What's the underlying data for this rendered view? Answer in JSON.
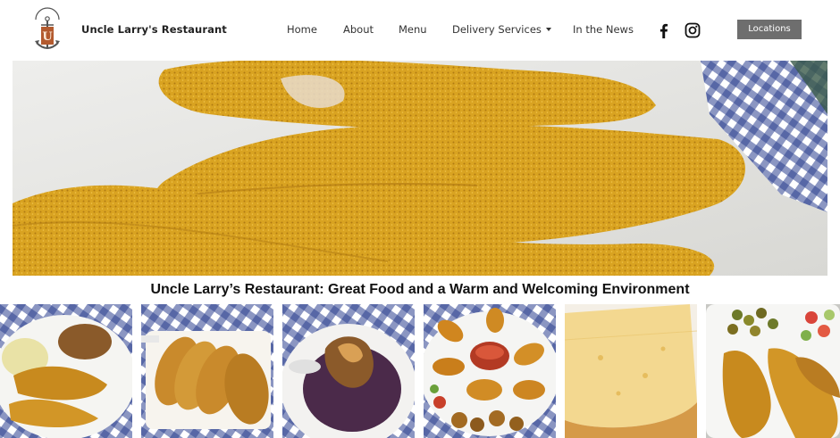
{
  "header": {
    "brand": "Uncle Larry's Restaurant",
    "logo_icon": "anchor-logo-icon",
    "nav": [
      {
        "label": "Home"
      },
      {
        "label": "About"
      },
      {
        "label": "Menu"
      },
      {
        "label": "Delivery Services",
        "has_dropdown": true
      },
      {
        "label": "In the News"
      }
    ],
    "social": [
      "facebook-icon",
      "instagram-icon"
    ],
    "cta_label": "Locations",
    "cta_color": "#6e6e6e"
  },
  "hero": {
    "subject": "fried-catfish-fillets-photo"
  },
  "headline": "Uncle Larry’s Restaurant: Great Food and a Warm and Welcoming Environment",
  "gallery": [
    {
      "subject": "catfish-plate-with-beans-and-cabbage"
    },
    {
      "subject": "hot-water-cornbread"
    },
    {
      "subject": "peach-cobbler-with-ice-cream"
    },
    {
      "subject": "fried-shrimp-platter"
    },
    {
      "subject": "cornbread-slice"
    },
    {
      "subject": "catfish-with-fried-okra-and-salad"
    }
  ],
  "colors": {
    "batter": "#d9a321",
    "gingham": "#2b3f8f",
    "text": "#222222"
  }
}
